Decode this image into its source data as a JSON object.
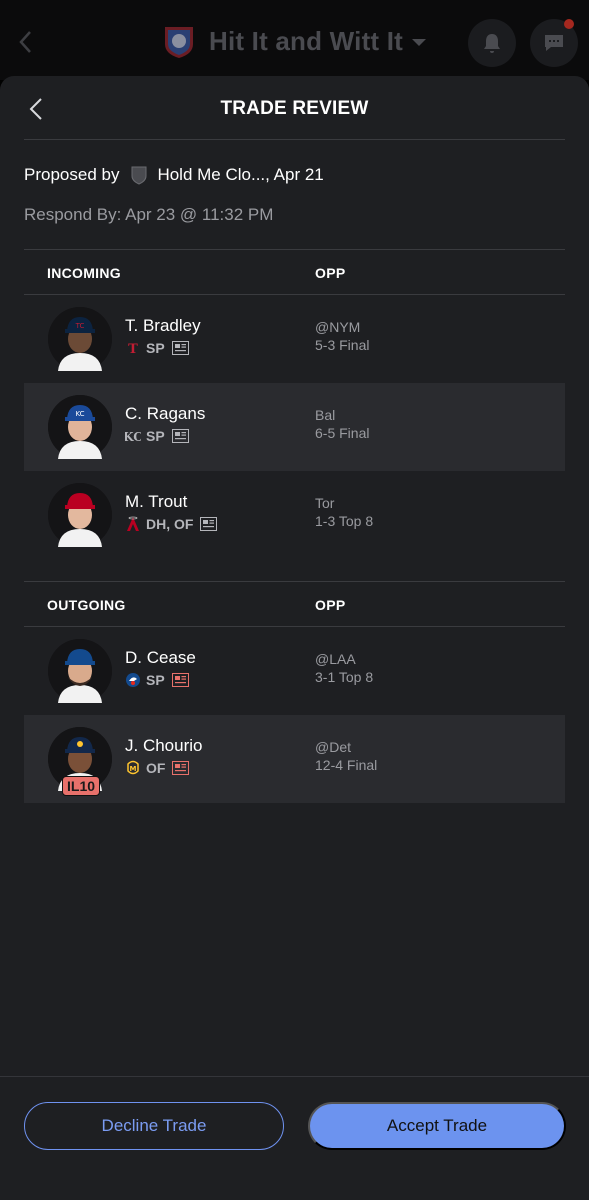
{
  "appbar": {
    "team_name": "Hit It and Witt It",
    "notification_dot_color": "#a5281f"
  },
  "sheet": {
    "title": "TRADE REVIEW",
    "proposed_prefix": "Proposed by",
    "proposed_team": "Hold Me Clo..., Apr 21",
    "respond_by": "Respond By: Apr 23 @ 11:32 PM"
  },
  "incoming": {
    "label": "INCOMING",
    "opp_label": "OPP",
    "players": [
      {
        "name": "T. Bradley",
        "team_icon": "twins-logo-icon",
        "positions": "SP",
        "game_line1": "@NYM",
        "game_line2": "5-3 Final",
        "news_color": "#b4b5ba",
        "cap_color": "#0c2340",
        "jersey_color": "#ffffff"
      },
      {
        "name": "C. Ragans",
        "team_icon": "royals-logo-icon",
        "positions": "SP",
        "game_line1": "Bal",
        "game_line2": "6-5 Final",
        "news_color": "#b4b5ba",
        "cap_color": "#1a4a9a",
        "jersey_color": "#ffffff"
      },
      {
        "name": "M. Trout",
        "team_icon": "angels-logo-icon",
        "positions": "DH, OF",
        "game_line1": "Tor",
        "game_line2": "1-3 Top 8",
        "news_color": "#b4b5ba",
        "cap_color": "#ba0021",
        "jersey_color": "#ffffff"
      }
    ]
  },
  "outgoing": {
    "label": "OUTGOING",
    "opp_label": "OPP",
    "players": [
      {
        "name": "D. Cease",
        "team_icon": "bluejays-logo-icon",
        "positions": "SP",
        "game_line1": "@LAA",
        "game_line2": "3-1 Top 8",
        "news_color": "#e8716b",
        "cap_color": "#134a8e",
        "jersey_color": "#ffffff"
      },
      {
        "name": "J. Chourio",
        "team_icon": "brewers-logo-icon",
        "positions": "OF",
        "game_line1": "@Det",
        "game_line2": "12-4 Final",
        "news_color": "#e8716b",
        "cap_color": "#12284b",
        "jersey_color": "#ffffff",
        "status": "IL10"
      }
    ]
  },
  "footer": {
    "decline_label": "Decline Trade",
    "accept_label": "Accept Trade",
    "accent_color": "#6c93ef"
  }
}
